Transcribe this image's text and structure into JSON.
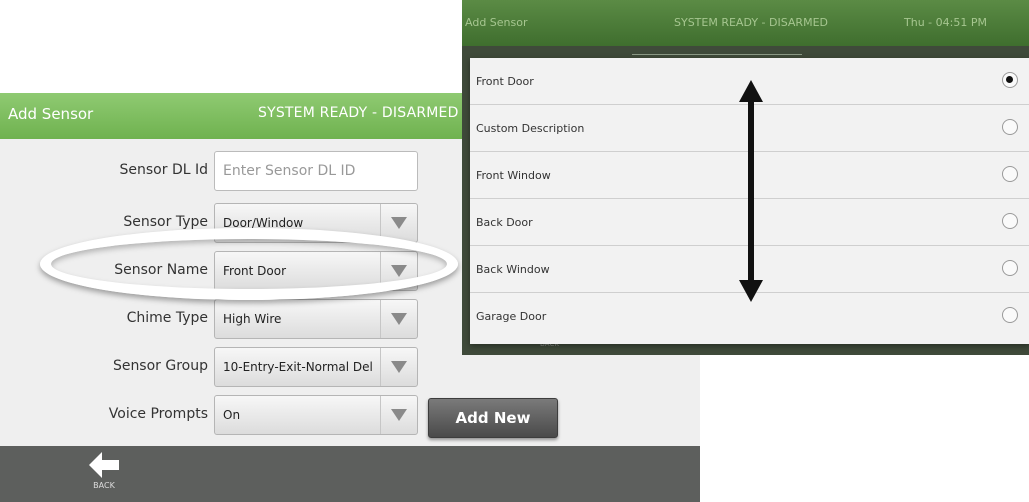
{
  "main_panel": {
    "header": {
      "title": "Add Sensor",
      "status": "SYSTEM READY - DISARMED"
    },
    "form": {
      "sensor_dl_id": {
        "label": "Sensor DL Id",
        "value": "",
        "placeholder": "Enter Sensor DL ID"
      },
      "sensor_type": {
        "label": "Sensor Type",
        "value": "Door/Window"
      },
      "sensor_name": {
        "label": "Sensor Name",
        "value": "Front Door"
      },
      "chime_type": {
        "label": "Chime Type",
        "value": "High Wire"
      },
      "sensor_group": {
        "label": "Sensor Group",
        "value": "10-Entry-Exit-Normal Del"
      },
      "voice_prompts": {
        "label": "Voice Prompts",
        "value": "On"
      }
    },
    "add_new_label": "Add New",
    "footer": {
      "back_label": "BACK"
    }
  },
  "overlay_panel": {
    "header": {
      "title": "Add Sensor",
      "status": "SYSTEM READY - DISARMED",
      "time": "Thu - 04:51 PM"
    },
    "back_hint": "BACK",
    "options": [
      {
        "label": "Front Door",
        "selected": true
      },
      {
        "label": "Custom Description",
        "selected": false
      },
      {
        "label": "Front Window",
        "selected": false
      },
      {
        "label": "Back Door",
        "selected": false
      },
      {
        "label": "Back Window",
        "selected": false
      },
      {
        "label": "Garage Door",
        "selected": false
      }
    ]
  },
  "colors": {
    "header_green": "#7bbd5b",
    "footer_gray": "#5d5f5d",
    "overlay_header_green": "#4c7c39"
  },
  "icons": {
    "dropdown": "dropdown-arrow-icon",
    "back": "back-arrow-icon",
    "scroll": "scroll-updown-arrow-icon"
  }
}
